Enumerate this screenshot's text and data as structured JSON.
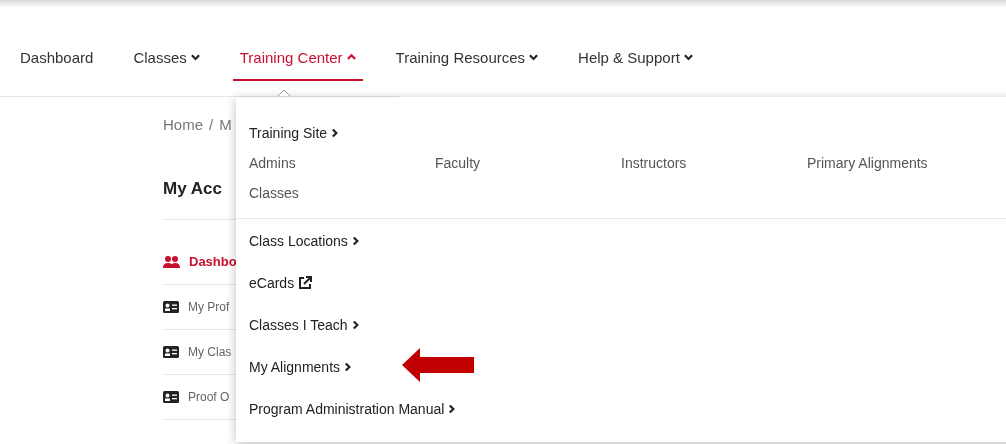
{
  "nav": [
    {
      "label": "Dashboard",
      "kind": "link",
      "selected": false
    },
    {
      "label": "Classes",
      "kind": "dropdown",
      "selected": false,
      "expanded": false
    },
    {
      "label": "Training Center",
      "kind": "dropdown",
      "selected": true,
      "expanded": true
    },
    {
      "label": "Training Resources",
      "kind": "dropdown",
      "selected": false,
      "expanded": false
    },
    {
      "label": "Help & Support",
      "kind": "dropdown",
      "selected": false,
      "expanded": false
    }
  ],
  "breadcrumb": {
    "items": [
      "Home",
      "M"
    ],
    "separator": "/"
  },
  "page_title": "My Acc",
  "sidebar": {
    "items": [
      {
        "label": "Dashbo",
        "selected": true
      },
      {
        "label": "My Prof",
        "selected": false
      },
      {
        "label": "My Clas",
        "selected": false
      },
      {
        "label": "Proof O",
        "selected": false
      }
    ]
  },
  "dropdown": {
    "training_site": {
      "label": "Training Site",
      "links": [
        "Admins",
        "Faculty",
        "Instructors",
        "Primary Alignments",
        "Classes"
      ]
    },
    "items": [
      {
        "label": "Class Locations",
        "kind": "submenu"
      },
      {
        "label": "eCards",
        "kind": "external"
      },
      {
        "label": "Classes I Teach",
        "kind": "submenu"
      },
      {
        "label": "My Alignments",
        "kind": "submenu",
        "highlighted": true
      },
      {
        "label": "Program Administration Manual",
        "kind": "submenu"
      }
    ]
  }
}
